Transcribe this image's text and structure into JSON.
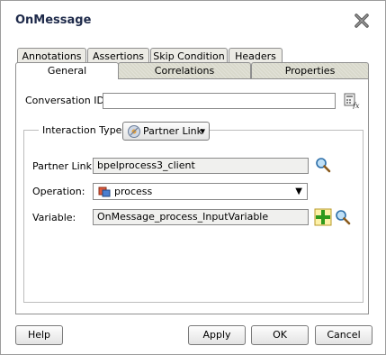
{
  "dialog": {
    "title": "OnMessage"
  },
  "tabs_back": [
    {
      "label": "Annotations"
    },
    {
      "label": "Assertions"
    },
    {
      "label": "Skip Condition"
    },
    {
      "label": "Headers"
    }
  ],
  "tabs_front": [
    {
      "label": "General",
      "active": true
    },
    {
      "label": "Correlations",
      "active": false
    },
    {
      "label": "Properties",
      "active": false
    }
  ],
  "conversation": {
    "label": "Conversation ID:",
    "value": ""
  },
  "interaction": {
    "label": "Interaction Type:",
    "value": "Partner Link"
  },
  "partner_link": {
    "label": "Partner Link:",
    "value": "bpelprocess3_client"
  },
  "operation": {
    "label": "Operation:",
    "value": "process"
  },
  "variable": {
    "label": "Variable:",
    "value": "OnMessage_process_InputVariable"
  },
  "buttons": {
    "help": "Help",
    "apply": "Apply",
    "ok": "OK",
    "cancel": "Cancel"
  },
  "icons": {
    "close": "close-x-icon",
    "expression_builder": "expression-builder-icon",
    "partner_link_type": "partner-link-icon",
    "search": "magnifier-icon",
    "add": "green-plus-icon",
    "operation": "operation-icon",
    "dropdown": "chevron-down-icon"
  }
}
